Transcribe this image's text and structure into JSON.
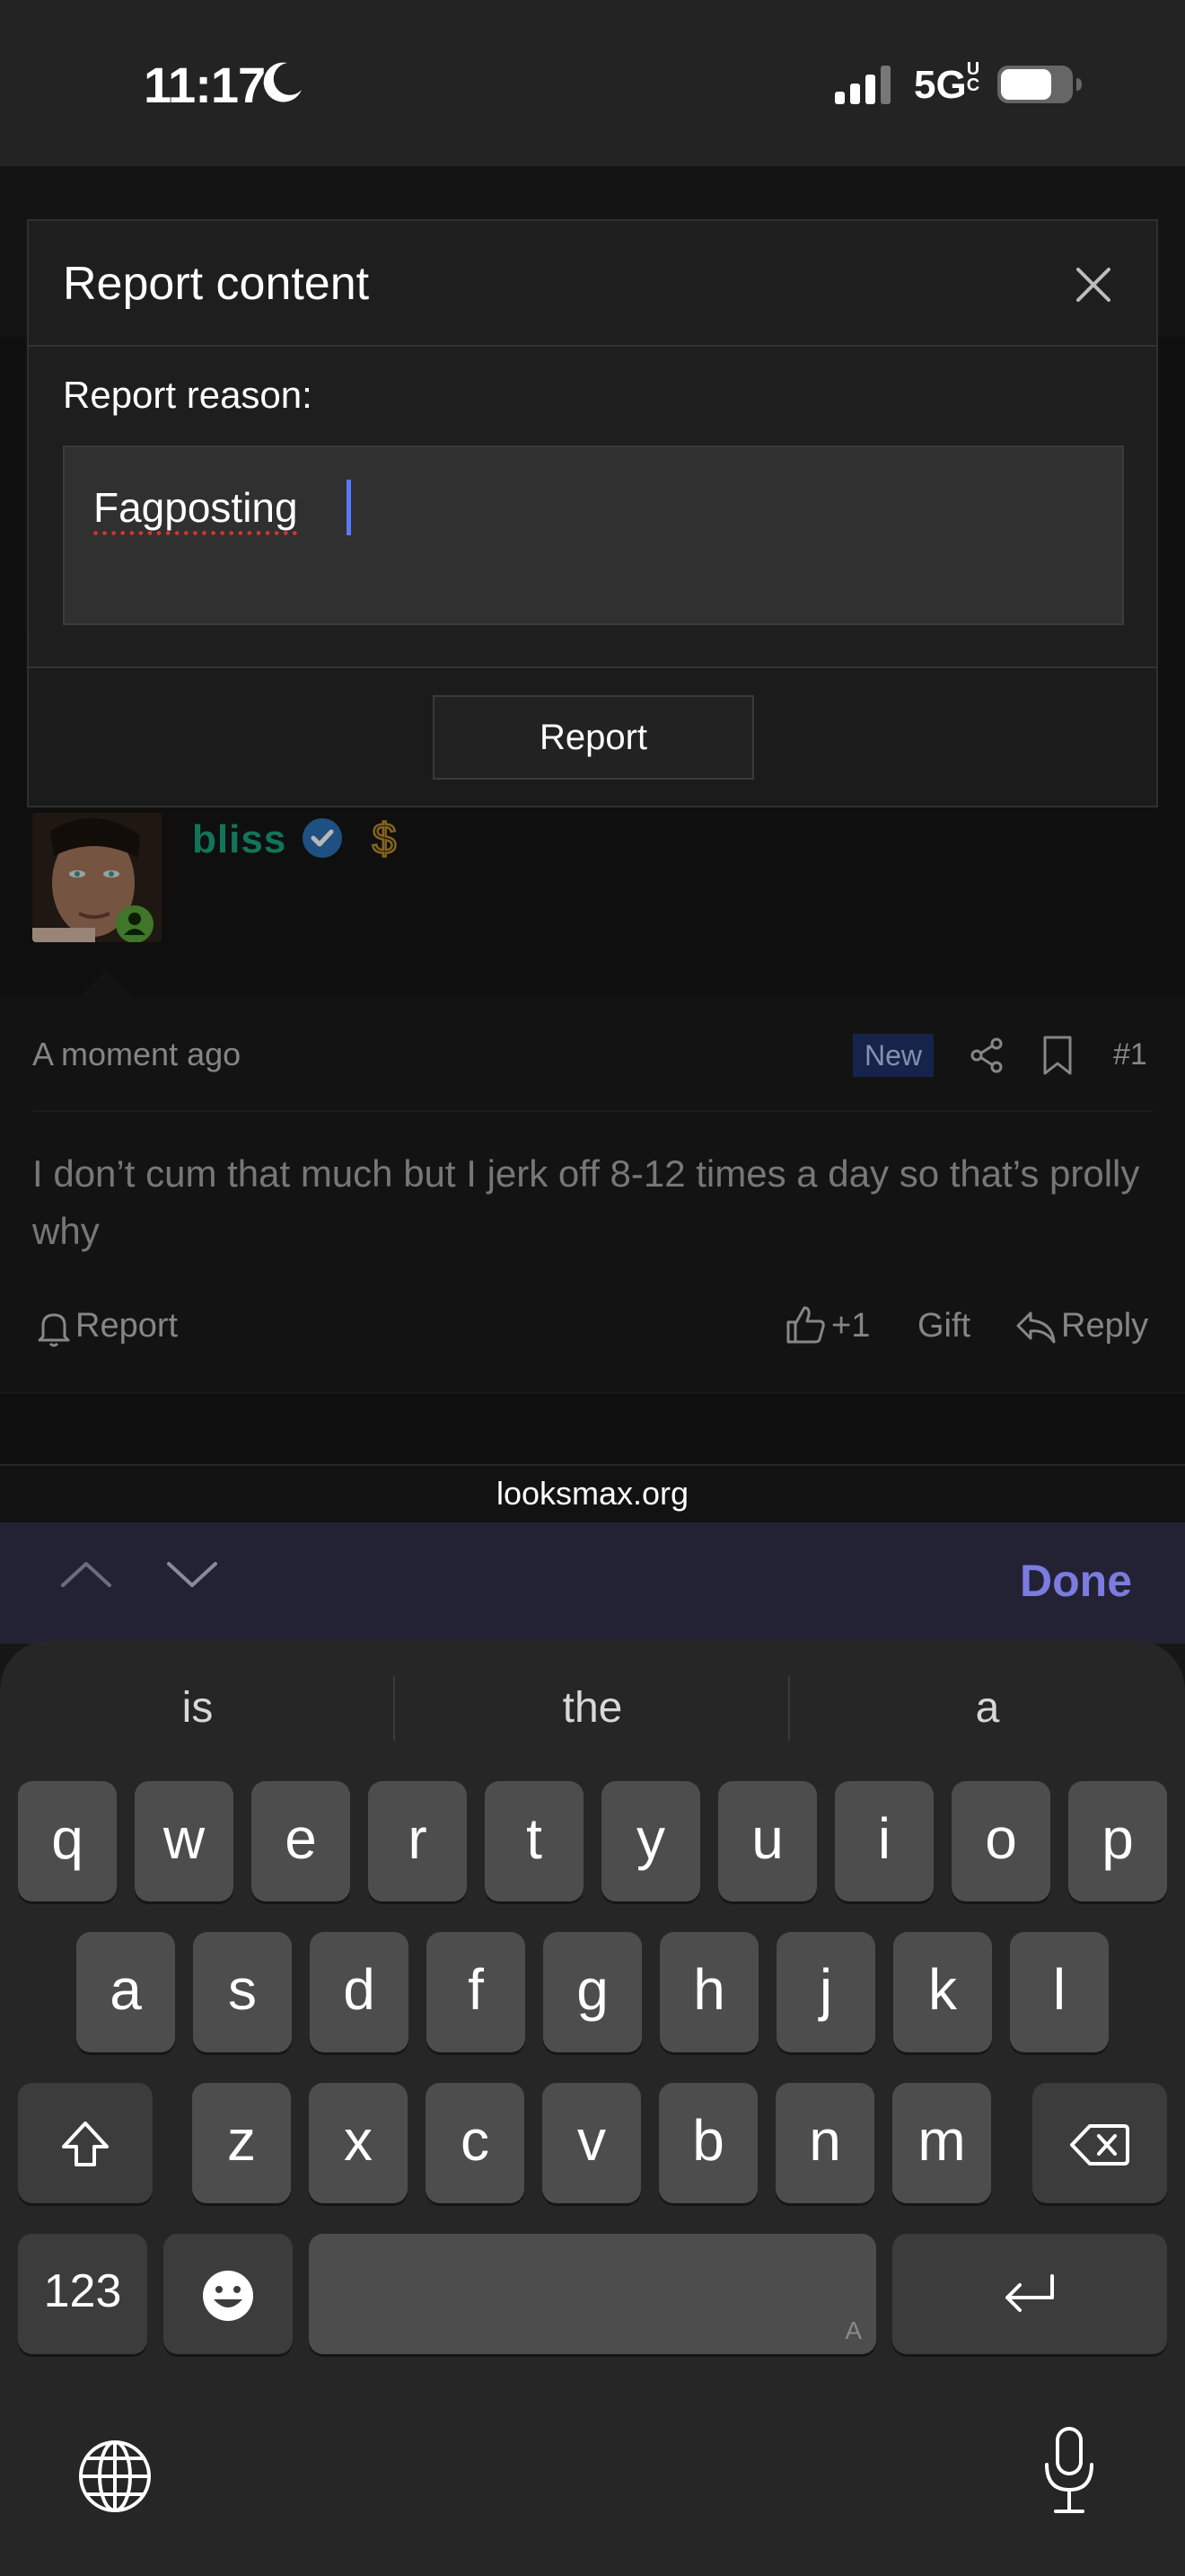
{
  "status_bar": {
    "time": "11:17",
    "network": "5G",
    "network_suffix": "UC"
  },
  "modal": {
    "title": "Report content",
    "reason_label": "Report reason:",
    "reason_value": "Fagposting",
    "submit_label": "Report"
  },
  "post": {
    "username": "bliss",
    "timestamp": "A moment ago",
    "badge": "New",
    "post_number": "#1",
    "body": "I don’t cum that much but I jerk off 8-12 times a day so that’s prolly why",
    "report_label": "Report",
    "like_label": "+1",
    "gift_label": "Gift",
    "reply_label": "Reply"
  },
  "browser": {
    "url": "looksmax.org"
  },
  "keyboard_accessory": {
    "done_label": "Done"
  },
  "keyboard": {
    "suggestions": [
      "is",
      "the",
      "a"
    ],
    "row1": [
      "q",
      "w",
      "e",
      "r",
      "t",
      "y",
      "u",
      "i",
      "o",
      "p"
    ],
    "row2": [
      "a",
      "s",
      "d",
      "f",
      "g",
      "h",
      "j",
      "k",
      "l"
    ],
    "row3": [
      "z",
      "x",
      "c",
      "v",
      "b",
      "n",
      "m"
    ],
    "numbers_label": "123",
    "space_corner": "A"
  },
  "colors": {
    "accent": "#7b7be0",
    "caret": "#5b79ff",
    "username": "#1aa37a"
  }
}
